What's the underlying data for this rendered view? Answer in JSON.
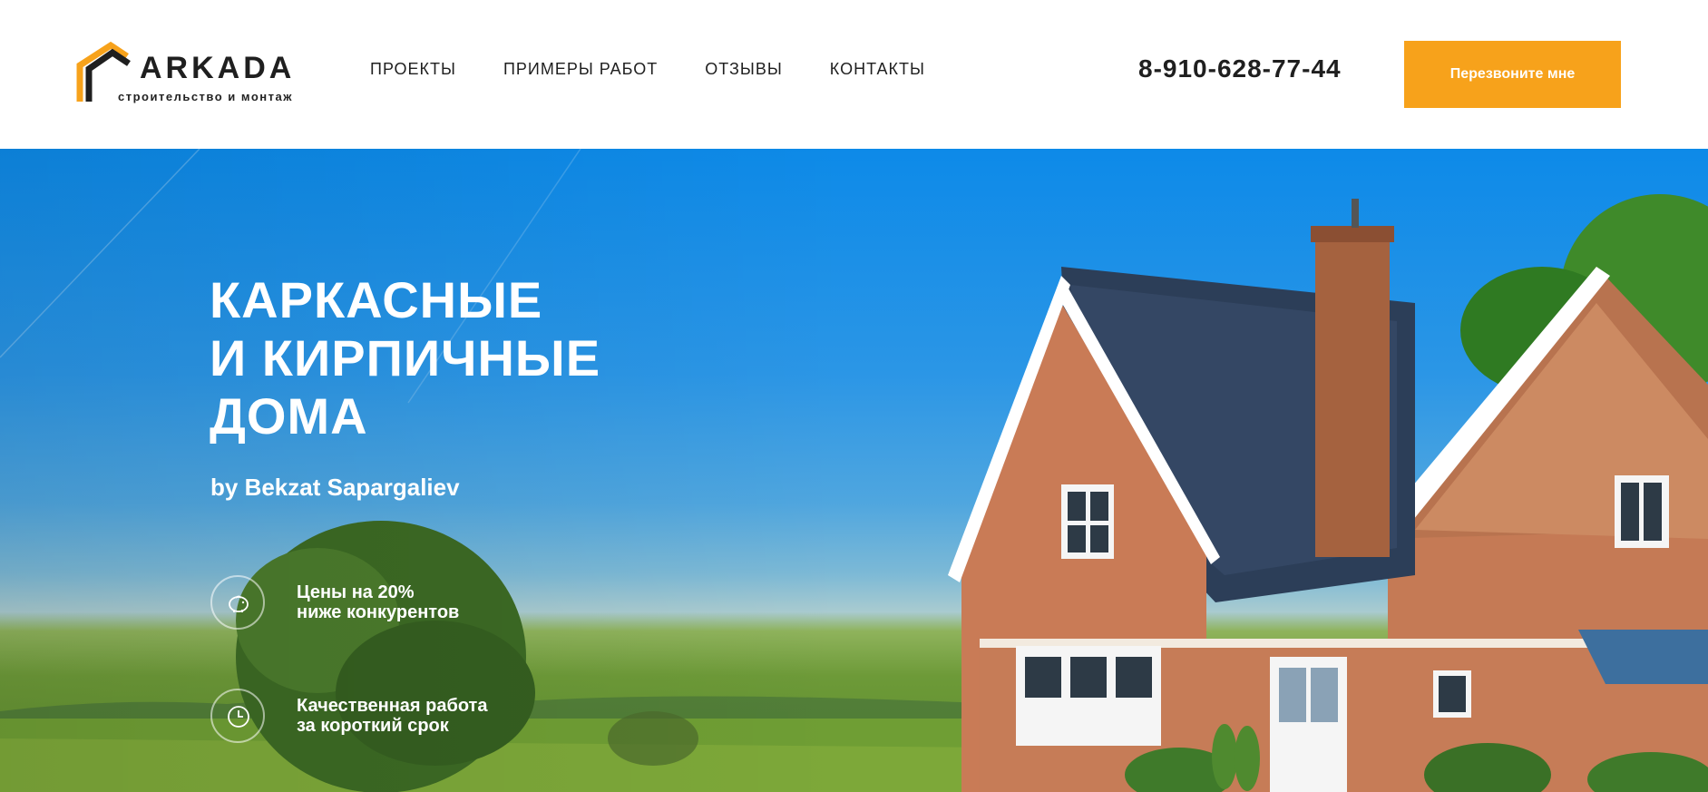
{
  "logo": {
    "name": "ARKADA",
    "tagline": "строительство и монтаж"
  },
  "nav": [
    {
      "label": "ПРОЕКТЫ"
    },
    {
      "label": "ПРИМЕРЫ РАБОТ"
    },
    {
      "label": "ОТЗЫВЫ"
    },
    {
      "label": "КОНТАКТЫ"
    }
  ],
  "phone": "8-910-628-77-44",
  "cta_label": "Перезвоните мне",
  "hero": {
    "title_lines": [
      "КАРКАСНЫЕ",
      "И КИРПИЧНЫЕ",
      "ДОМА"
    ],
    "author": "by Bekzat Sapargaliev",
    "features": [
      {
        "icon": "piggy-bank-icon",
        "lines": [
          "Цены на 20%",
          "ниже конкурентов"
        ]
      },
      {
        "icon": "clock-icon",
        "lines": [
          "Качественная работа",
          "за короткий срок"
        ]
      }
    ]
  },
  "colors": {
    "accent": "#f7a21b",
    "text_dark": "#1f1f1f",
    "sky": "#0d8ae8"
  }
}
